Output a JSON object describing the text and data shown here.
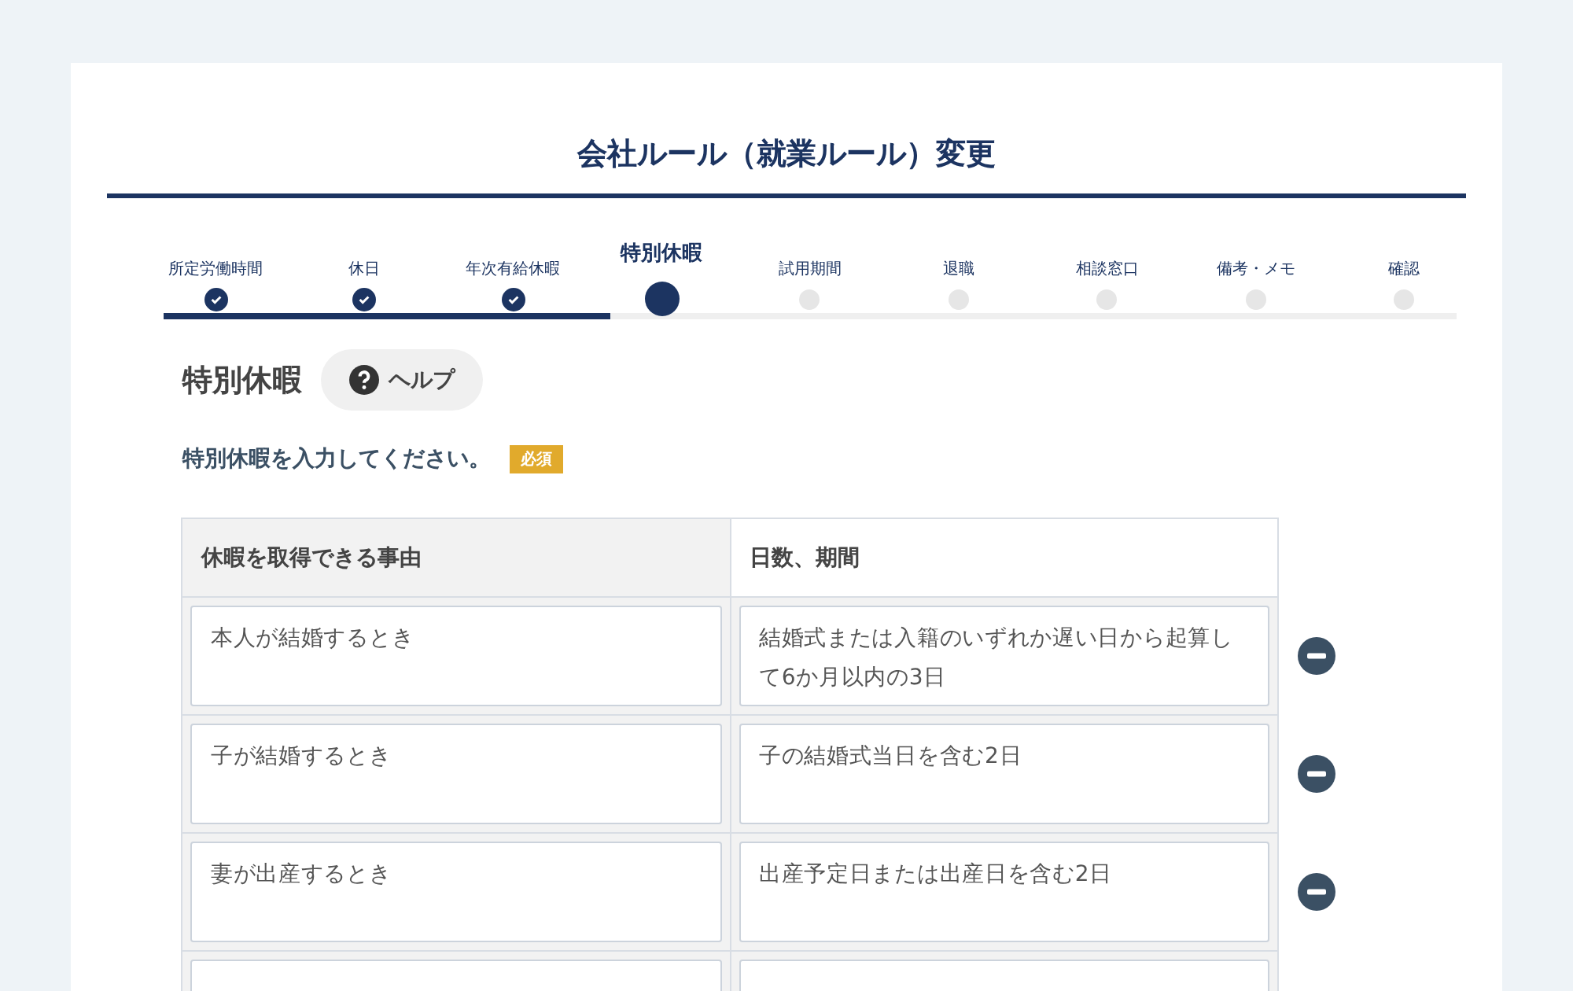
{
  "title": "会社ルール（就業ルール）変更",
  "steps": [
    {
      "label": "所定労働時間",
      "done": true,
      "selected": false
    },
    {
      "label": "休日",
      "done": true,
      "selected": false
    },
    {
      "label": "年次有給休暇",
      "done": true,
      "selected": false
    },
    {
      "label": "特別休暇",
      "done": false,
      "selected": true
    },
    {
      "label": "試用期間",
      "done": false,
      "selected": false
    },
    {
      "label": "退職",
      "done": false,
      "selected": false
    },
    {
      "label": "相談窓口",
      "done": false,
      "selected": false
    },
    {
      "label": "備考・メモ",
      "done": false,
      "selected": false
    },
    {
      "label": "確認",
      "done": false,
      "selected": false
    }
  ],
  "section": {
    "heading": "特別休暇",
    "help_button": "ヘルプ"
  },
  "instruction": "特別休暇を入力してください。",
  "required_badge": "必須",
  "table": {
    "columns": [
      "休暇を取得できる事由",
      "日数、期間"
    ],
    "rows": [
      {
        "reason": "本人が結婚するとき",
        "period": "結婚式または入籍のいずれか遅い日から起算して6か月以内の3日"
      },
      {
        "reason": "子が結婚するとき",
        "period": "子の結婚式当日を含む2日"
      },
      {
        "reason": "妻が出産するとき",
        "period": "出産予定日または出産日を含む2日"
      },
      {}
    ]
  }
}
